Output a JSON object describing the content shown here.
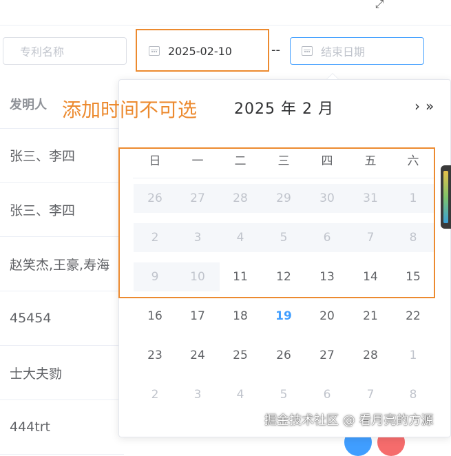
{
  "filters": {
    "name_placeholder": "专利名称",
    "start_value": "2025-02-10",
    "separator": "--",
    "end_placeholder": "结束日期"
  },
  "table": {
    "header": "发明人",
    "rows": [
      "张三、李四",
      "张三、李四",
      "赵笑杰,王豪,寿海",
      "45454",
      "士大夫勠",
      "444trt"
    ]
  },
  "annotation": "添加时间不可选",
  "calendar": {
    "title": "2025 年  2 月",
    "next_month": "›",
    "next_year": "»",
    "weekdays": [
      "日",
      "一",
      "二",
      "三",
      "四",
      "五",
      "六"
    ],
    "weeks": [
      [
        "26",
        "27",
        "28",
        "29",
        "30",
        "31",
        "1"
      ],
      [
        "2",
        "3",
        "4",
        "5",
        "6",
        "7",
        "8"
      ],
      [
        "9",
        "10",
        "11",
        "12",
        "13",
        "14",
        "15"
      ],
      [
        "16",
        "17",
        "18",
        "19",
        "20",
        "21",
        "22"
      ],
      [
        "23",
        "24",
        "25",
        "26",
        "27",
        "28",
        "1"
      ],
      [
        "2",
        "3",
        "4",
        "5",
        "6",
        "7",
        "8"
      ]
    ],
    "today": "19",
    "disabled_through": "2025-02-10"
  },
  "watermark": "掘金技术社区 @ 看月亮的方源",
  "colors": {
    "highlight_box": "#ec8a2f",
    "today": "#409eff",
    "disabled_bg": "#f5f7fa"
  },
  "icons": [
    "expand-icon",
    "calendar-icon",
    "chevron-right-icon",
    "double-chevron-right-icon"
  ]
}
